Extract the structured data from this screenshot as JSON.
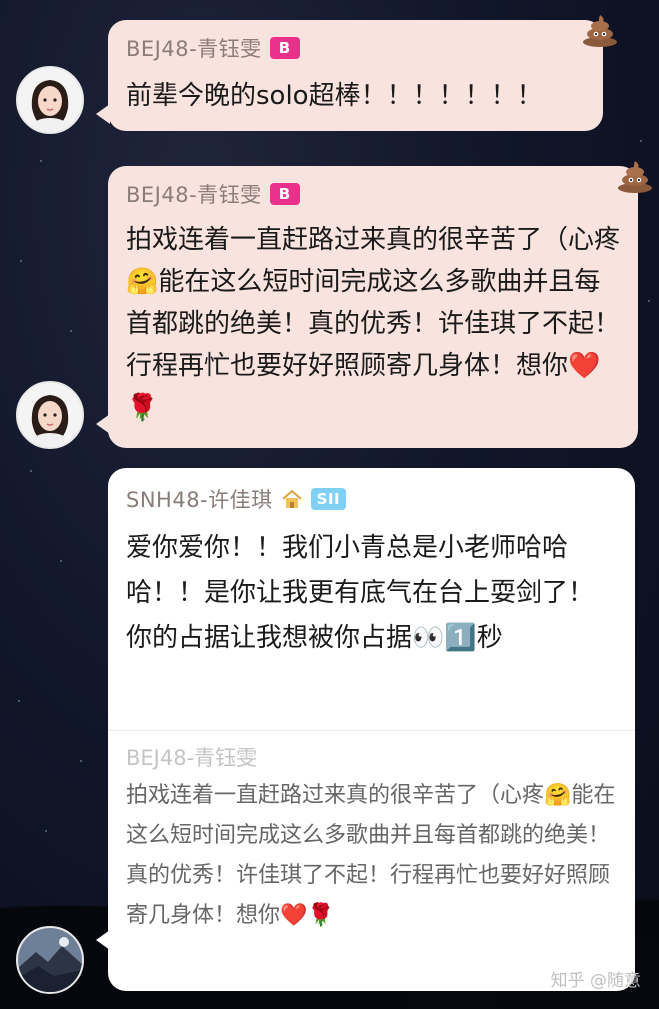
{
  "messages": [
    {
      "sender": "BEJ48-青钰雯",
      "badge": "B",
      "text": "前辈今晚的solo超棒！！！！！！！",
      "avatar_icon": "female-avatar-icon",
      "reaction_icon": "poop-icon"
    },
    {
      "sender": "BEJ48-青钰雯",
      "badge": "B",
      "text": "拍戏连着一直赶路过来真的很辛苦了（心疼🤗能在这么短时间完成这么多歌曲并且每首都跳的绝美！真的优秀！许佳琪了不起！行程再忙也要好好照顾寄几身体！想你❤️🌹",
      "avatar_icon": "female-avatar-icon",
      "reaction_icon": "poop-icon"
    },
    {
      "sender": "SNH48-许佳琪",
      "badge": "SII",
      "sender_icon": "home-icon",
      "text": "爱你爱你！！我们小青总是小老师哈哈哈！！是你让我更有底气在台上耍剑了！你的占据让我想被你占据👀1️⃣秒",
      "avatar_icon": "landscape-avatar-icon",
      "quote": {
        "sender": "BEJ48-青钰雯",
        "text": "拍戏连着一直赶路过来真的很辛苦了（心疼🤗能在这么短时间完成这么多歌曲并且每首都跳的绝美！真的优秀！许佳琪了不起！行程再忙也要好好照顾寄几身体！想你❤️🌹"
      }
    }
  ],
  "watermark": "知乎 @随意",
  "colors": {
    "pink_bubble": "#f9e3de",
    "white_bubble": "#ffffff",
    "badge_b": "#e9318b",
    "badge_sii": "#7fd0f2",
    "background": "#11162a"
  }
}
